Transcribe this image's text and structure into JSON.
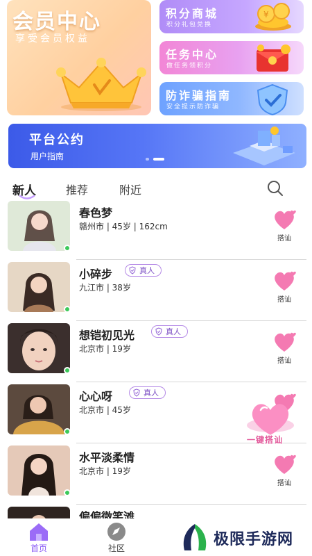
{
  "vip": {
    "title": "会员中心",
    "subtitle": "享受会员权益"
  },
  "menu_cards": [
    {
      "title": "积分商城",
      "subtitle": "积分礼包兑换"
    },
    {
      "title": "任务中心",
      "subtitle": "做任务领积分"
    },
    {
      "title": "防诈骗指南",
      "subtitle": "安全提示防诈骗"
    }
  ],
  "banner": {
    "title": "平台公约",
    "subtitle": "用户指南",
    "page_count": 2,
    "active_page": 2
  },
  "tabs": [
    {
      "label": "新人",
      "active": true
    },
    {
      "label": "推荐",
      "active": false
    },
    {
      "label": "附近",
      "active": false
    }
  ],
  "users": [
    {
      "name": "春色梦",
      "info": "赣州市 | 45岁 | 162cm",
      "verified": false,
      "verified_label": "",
      "action": "搭讪"
    },
    {
      "name": "小碎步",
      "info": "九江市 | 38岁",
      "verified": true,
      "verified_label": "真人",
      "action": "搭讪"
    },
    {
      "name": "想铠初见光",
      "info": "北京市 | 19岁",
      "verified": true,
      "verified_label": "真人",
      "action": "搭讪"
    },
    {
      "name": "心心呀",
      "info": "北京市 | 45岁",
      "verified": true,
      "verified_label": "真人",
      "action": ""
    },
    {
      "name": "水平淡柔情",
      "info": "北京市 | 19岁",
      "verified": false,
      "verified_label": "",
      "action": "搭讪"
    },
    {
      "name": "偏偏微笑滩",
      "info": "",
      "verified": false,
      "verified_label": "",
      "action": ""
    }
  ],
  "quick_chat": {
    "label": "一键搭讪"
  },
  "bottom_nav": [
    {
      "label": "首页",
      "icon": "home-icon",
      "active": true
    },
    {
      "label": "社区",
      "icon": "compass-icon",
      "active": false
    }
  ],
  "watermark": {
    "text": "极限手游网"
  },
  "colors": {
    "accent": "#8b5cf6",
    "heart": "#f47ab2",
    "online": "#3cc95a",
    "badge_border": "#b58ae6"
  }
}
